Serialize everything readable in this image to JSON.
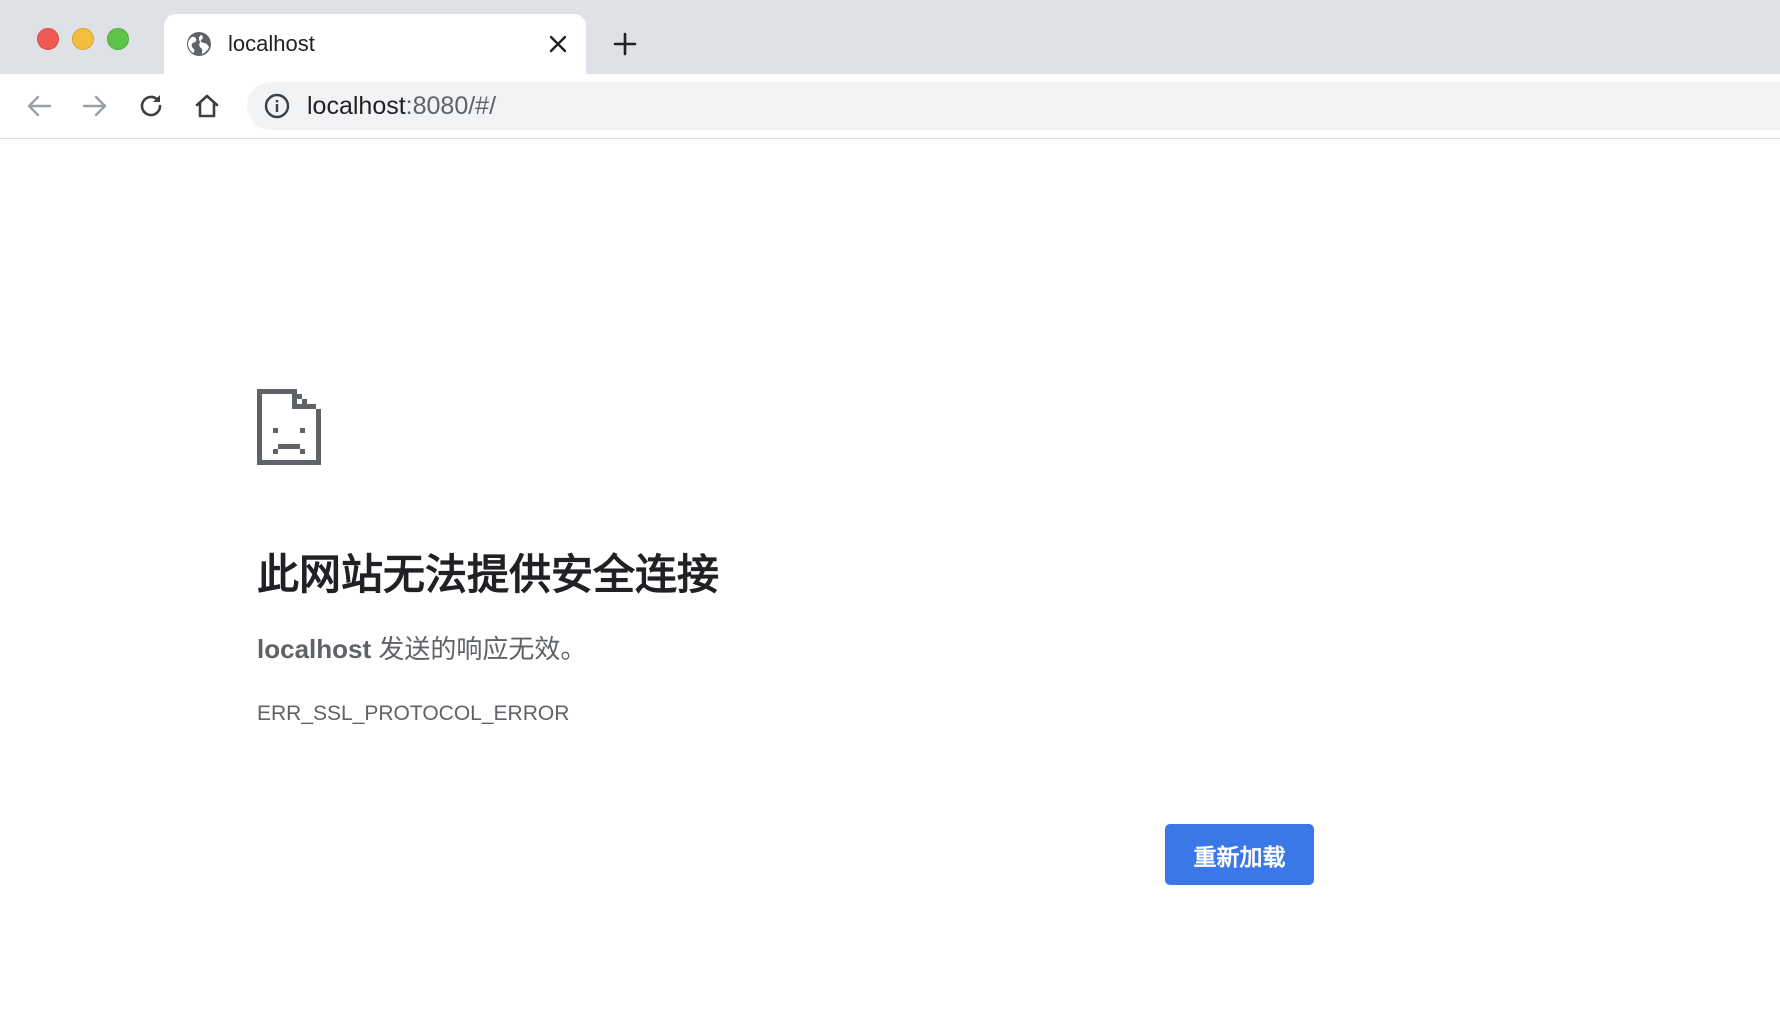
{
  "browser": {
    "tab": {
      "title": "localhost",
      "favicon": "globe-icon",
      "close_icon": "close-icon"
    },
    "new_tab_icon": "plus-icon",
    "nav": {
      "back_icon": "arrow-left-icon",
      "forward_icon": "arrow-right-icon",
      "reload_icon": "reload-icon",
      "home_icon": "home-icon"
    },
    "omnibox": {
      "info_icon": "info-icon",
      "host": "localhost",
      "rest": ":8080/#/"
    }
  },
  "error_page": {
    "icon": "sad-page-icon",
    "title": "此网站无法提供安全连接",
    "description_host": "localhost",
    "description_text": " 发送的响应无效。",
    "error_code": "ERR_SSL_PROTOCOL_ERROR",
    "reload_label": "重新加载"
  },
  "colors": {
    "accent": "#3b78e7",
    "tabbar_bg": "#dee1e6",
    "text_primary": "#202124",
    "text_secondary": "#5f6368"
  }
}
